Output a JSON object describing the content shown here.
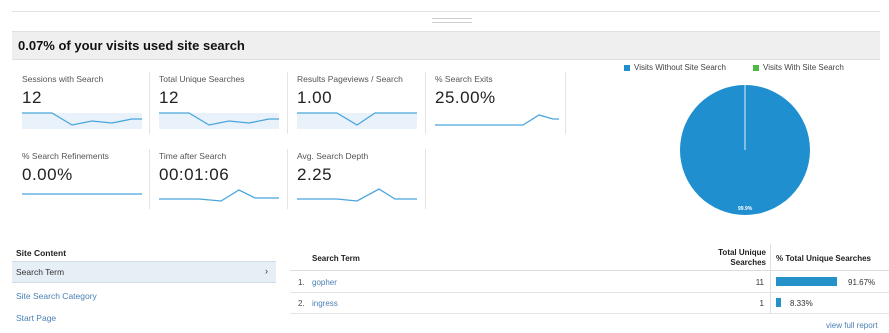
{
  "title": "0.07% of your visits used site search",
  "metrics": [
    {
      "label": "Sessions with Search",
      "value": "12"
    },
    {
      "label": "Total Unique Searches",
      "value": "12"
    },
    {
      "label": "Results Pageviews / Search",
      "value": "1.00"
    },
    {
      "label": "% Search Exits",
      "value": "25.00%"
    },
    {
      "label": "% Search Refinements",
      "value": "0.00%"
    },
    {
      "label": "Time after Search",
      "value": "00:01:06"
    },
    {
      "label": "Avg. Search Depth",
      "value": "2.25"
    }
  ],
  "pie": {
    "legend": [
      {
        "label": "Visits Without Site Search",
        "color": "#1f8fcf"
      },
      {
        "label": "Visits With Site Search",
        "color": "#4fb848"
      }
    ],
    "slice_label": "99.9%",
    "values": [
      99.93,
      0.07
    ]
  },
  "site_content": {
    "title": "Site Content",
    "active": "Search Term",
    "links": [
      "Site Search Category",
      "Start Page"
    ]
  },
  "table": {
    "col_term": "Search Term",
    "col_total_line1": "Total Unique",
    "col_total_line2": "Searches",
    "col_pct": "% Total Unique Searches",
    "rows": [
      {
        "num": "1.",
        "term": "gopher",
        "count": "11",
        "pct": "91.67%",
        "fraction": 0.9167
      },
      {
        "num": "2.",
        "term": "ingress",
        "count": "1",
        "pct": "8.33%",
        "fraction": 0.0833
      }
    ],
    "view_full": "view full report"
  }
}
